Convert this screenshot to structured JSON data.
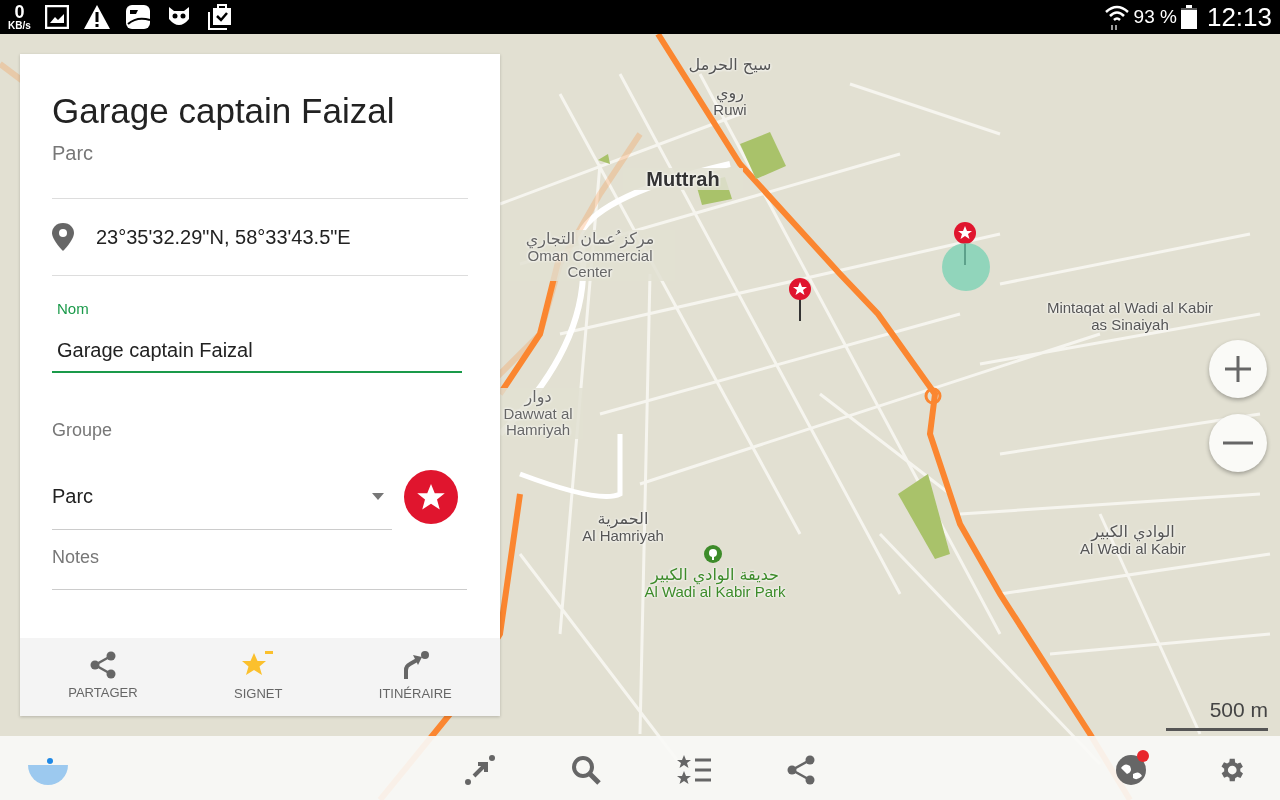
{
  "status_bar": {
    "net_speed": "0",
    "net_unit": "KB/s",
    "battery": "93 %",
    "time": "12:13"
  },
  "place_panel": {
    "title": "Garage captain Faizal",
    "subtitle": "Parc",
    "coordinates": "23°35'32.29\"N, 58°33'43.5\"E",
    "name_field": {
      "label": "Nom",
      "value": "Garage captain Faizal"
    },
    "group_field": {
      "label": "Groupe",
      "value": "Parc"
    },
    "notes_field": {
      "placeholder": "Notes"
    },
    "actions": [
      {
        "kind": "share",
        "label": "PARTAGER"
      },
      {
        "kind": "bookmark",
        "label": "SIGNET"
      },
      {
        "kind": "route",
        "label": "ITINÉRAIRE"
      }
    ]
  },
  "map": {
    "labels": [
      {
        "kind": "place",
        "ar": "سيح الحرمل"
      },
      {
        "kind": "place",
        "ar": "روي",
        "en": "Ruwi"
      },
      {
        "kind": "city",
        "en": "Muttrah"
      },
      {
        "kind": "poi",
        "ar": "مركز ُعمان التجاري",
        "en": "Oman Commercial Center"
      },
      {
        "kind": "poi",
        "ar": "دوار",
        "en": "Dawwat al Hamriyah"
      },
      {
        "kind": "place",
        "en": "Mintaqat al Wadi al Kabir as Sinaiyah"
      },
      {
        "kind": "place",
        "ar": "الحمرية",
        "en": "Al Hamriyah"
      },
      {
        "kind": "park",
        "ar": "حديقة الوادي الكبير",
        "en": "Al Wadi al Kabir Park"
      },
      {
        "kind": "place",
        "ar": "الوادي الكبير",
        "en": "Al Wadi al Kabir"
      }
    ],
    "scale": "500 m"
  },
  "toolbar": {
    "downloads_badge": true
  }
}
